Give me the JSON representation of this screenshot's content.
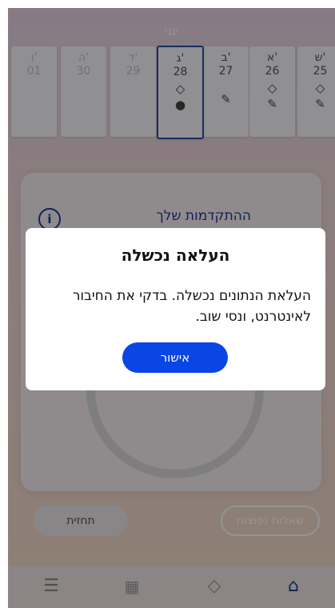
{
  "header": {
    "month": "יוני"
  },
  "days": [
    {
      "name": "ש'",
      "num": "25",
      "icons": [
        "◇",
        "✎"
      ],
      "state": "normal"
    },
    {
      "name": "א'",
      "num": "26",
      "icons": [
        "◇",
        "✎"
      ],
      "state": "normal"
    },
    {
      "name": "ב'",
      "num": "27",
      "icons": [
        "✎"
      ],
      "state": "normal"
    },
    {
      "name": "ג'",
      "num": "28",
      "icons": [
        "◇",
        "💧"
      ],
      "state": "selected"
    },
    {
      "name": "ד'",
      "num": "29",
      "icons": [],
      "state": "faded"
    },
    {
      "name": "ה'",
      "num": "30",
      "icons": [],
      "state": "faded"
    },
    {
      "name": "ו'",
      "num": "01",
      "icons": [],
      "state": "faded"
    }
  ],
  "progress_card": {
    "title": "ההתקדמות שלך",
    "info_icon": "i"
  },
  "buttons": {
    "forecast": "תחזית",
    "faq": "שאלות נפוצות"
  },
  "nav": {
    "menu_icon": "☰",
    "calendar_icon": "▦",
    "gem_icon": "◇",
    "home_icon": "⌂"
  },
  "dialog": {
    "title": "העלאה נכשלה",
    "message": "העלאת הנתונים נכשלה. בדקי את החיבור לאינטרנט, ונסי שוב.",
    "confirm": "אישור"
  },
  "colors": {
    "accent": "#0a45e6",
    "title_blue": "#1a3b9a",
    "drop": "#c2223c"
  }
}
